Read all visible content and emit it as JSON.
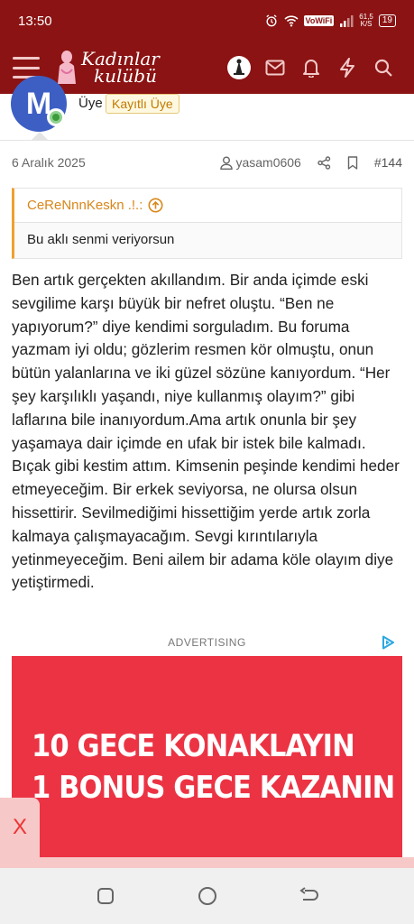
{
  "status_bar": {
    "time": "13:50",
    "network_label": "VoWiFi",
    "speed_value": "61,5",
    "speed_unit": "K/S",
    "battery": "19"
  },
  "app_bar": {
    "logo_line1": "Kadınlar",
    "logo_line2": "kulübü",
    "brand_color": "#8b1313"
  },
  "user": {
    "avatar_letter": "M",
    "role": "Üye",
    "badge": "Kayıtlı Üye"
  },
  "post_meta": {
    "date": "6 Aralık 2025",
    "author": "yasam0606",
    "post_number": "#144"
  },
  "quote": {
    "author": "CeReNnnKeskn .!.:",
    "text": "Bu aklı senmi veriyorsun"
  },
  "post": {
    "body": "Ben artık gerçekten akıllandım. Bir anda içimde eski sevgilime karşı büyük bir nefret oluştu. “Ben ne yapıyorum?” diye kendimi sorguladım. Bu foruma yazmam iyi oldu; gözlerim resmen kör olmuştu, onun bütün yalanlarına ve iki güzel sözüne kanıyordum. “Her şey karşılıklı yaşandı, niye kullanmış olayım?” gibi laflarına bile inanıyordum.Ama artık onunla bir şey yaşamaya dair içimde en ufak bir istek bile kalmadı. Bıçak gibi kestim attım. Kimsenin peşinde kendimi heder etmeyeceğim. Bir erkek seviyorsa, ne olursa olsun hissettirir. Sevilmediğimi hissettiğim yerde artık zorla kalmaya çalışmayacağım. Sevgi kırıntılarıyla yetinmeyeceğim. Beni ailem bir adama köle olayım diye yetiştirmedi."
  },
  "ad": {
    "label": "ADVERTISING",
    "line1": "10 GECE KONAKLAYIN",
    "line2": "1 BONUS  GECE KAZANIN",
    "background_color": "#ec3344",
    "close_label": "X"
  }
}
